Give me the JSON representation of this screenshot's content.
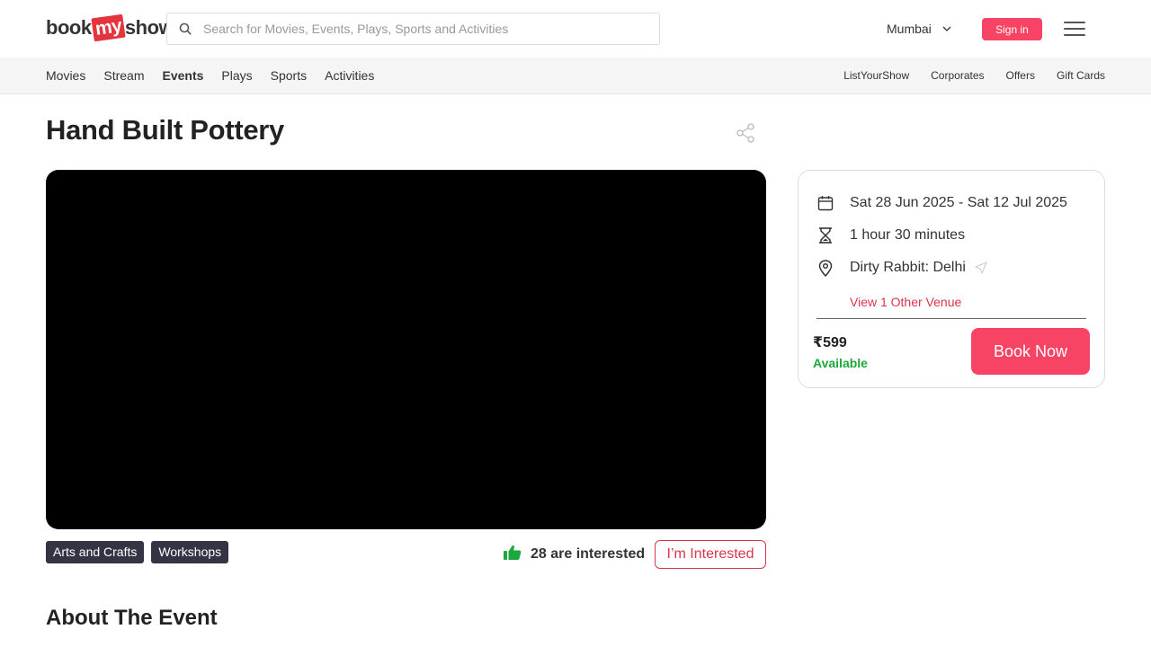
{
  "header": {
    "logo": {
      "pre": "book",
      "mid": "my",
      "post": "show"
    },
    "search_placeholder": "Search for Movies, Events, Plays, Sports and Activities",
    "city": "Mumbai",
    "signin_label": "Sign in"
  },
  "subnav": {
    "left": [
      "Movies",
      "Stream",
      "Events",
      "Plays",
      "Sports",
      "Activities"
    ],
    "active": "Events",
    "right": [
      "ListYourShow",
      "Corporates",
      "Offers",
      "Gift Cards"
    ]
  },
  "event": {
    "title": "Hand Built Pottery",
    "tags": [
      "Arts and Crafts",
      "Workshops"
    ],
    "interested_count": "28 are interested",
    "interested_button": "I’m Interested",
    "about_heading": "About The Event"
  },
  "card": {
    "dates": "Sat 28 Jun 2025 - Sat 12 Jul 2025",
    "duration": "1 hour 30 minutes",
    "venue": "Dirty Rabbit: Delhi",
    "other_venue": "View 1 Other Venue",
    "price": "₹599",
    "availability": "Available",
    "book_label": "Book Now"
  },
  "colors": {
    "brand": "#f84464",
    "accent_red": "#dc354b",
    "available_green": "#1ea83c",
    "tag_bg": "#333545"
  },
  "icons": [
    "search-icon",
    "chevron-down-icon",
    "hamburger-menu-icon",
    "share-icon",
    "calendar-icon",
    "hourglass-icon",
    "location-pin-icon",
    "navigate-arrow-icon",
    "thumbs-up-icon"
  ]
}
